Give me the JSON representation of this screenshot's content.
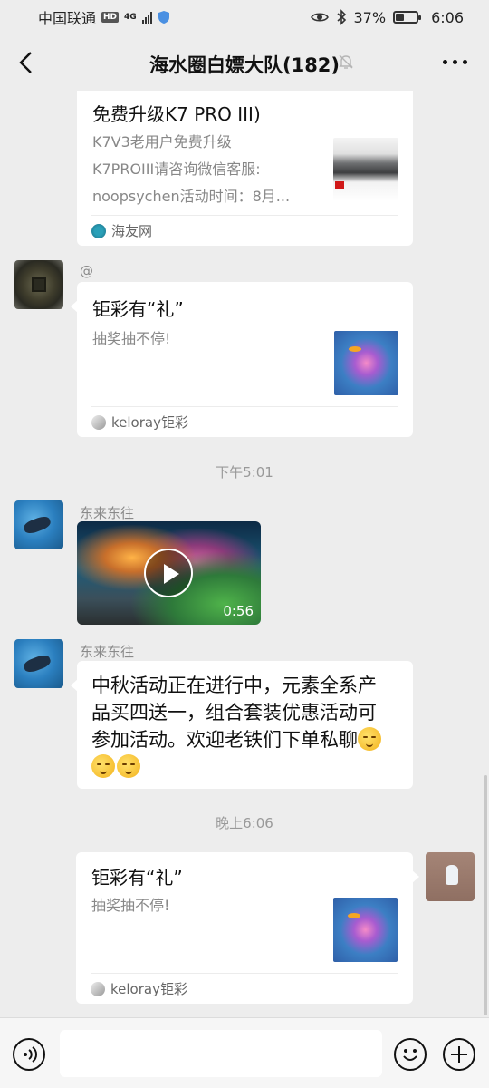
{
  "status_bar": {
    "carrier": "中国联通",
    "network_hd": "HD",
    "network_gen": "4G",
    "battery": "37%",
    "battery_level": 0.37,
    "time": "6:06"
  },
  "header": {
    "title": "海水圈白嫖大队(182)"
  },
  "messages": {
    "card1": {
      "title": "免费升级K7 PRO III)",
      "desc_lines": [
        "K7V3老用户免费升级",
        "K7PROIII请咨询微信客服:",
        "noopsychen活动时间：8月..."
      ],
      "source": "海友网"
    },
    "msg2": {
      "sender": "@",
      "card_title": "钜彩有“礼”",
      "card_desc": "抽奖抽不停!",
      "source": "keloray钜彩"
    },
    "time1": "下午5:01",
    "msg3": {
      "sender": "东来东往",
      "video_duration": "0:56"
    },
    "msg4": {
      "sender": "东来东往",
      "text_lines": [
        "中秋活动正在进行中，元素全系产",
        "品买四送一，组合套装优惠活动可",
        "参加活动。欢迎老铁们下单私聊"
      ]
    },
    "time2": "晚上6:06",
    "msg5": {
      "card_title": "钜彩有“礼”",
      "card_desc": "抽奖抽不停!",
      "source": "keloray钜彩"
    }
  },
  "colors": {
    "background": "#ededed",
    "bubble": "#ffffff",
    "meta_text": "#999999"
  },
  "icons": [
    "back-arrow-icon",
    "mute-bell-icon",
    "more-dots-icon",
    "voice-icon",
    "emoji-icon",
    "plus-icon",
    "play-icon"
  ]
}
